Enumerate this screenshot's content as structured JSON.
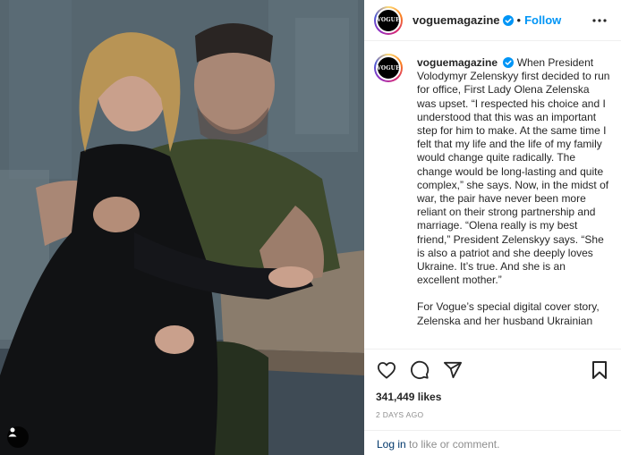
{
  "post": {
    "photo_alt": "",
    "author": {
      "username": "voguemagazine",
      "avatar_text": "VOGUE",
      "verified": true
    },
    "header": {
      "dot": "•",
      "follow_label": "Follow",
      "more_icon": "more-horizontal-icon"
    },
    "caption": {
      "username": "voguemagazine",
      "paragraph_1": "When President Volodymyr Zelenskyy first decided to run for office, First Lady Olena Zelenska was upset. “I respected his choice and I understood that this was an important step for him to make. At the same time I felt that my life and the life of my family would change quite radically. The change would be long-lasting and quite complex,” she says. Now, in the midst of war, the pair have never been more reliant on their strong partnership and marriage. “Olena really is my best friend,” President Zelenskyy says. “She is also a patriot and she deeply loves Ukraine. It’s true. And she is an excellent mother.”",
      "paragraph_2": "For Vogue’s special digital cover story, Zelenska and her husband Ukrainian"
    },
    "actions": {
      "like_icon": "heart-icon",
      "comment_icon": "comment-icon",
      "share_icon": "share-icon",
      "save_icon": "bookmark-icon"
    },
    "likes": "341,449 likes",
    "time_ago": "2 DAYS AGO",
    "login": {
      "link_label": "Log in",
      "rest_text": " to like or comment."
    }
  },
  "colors": {
    "link": "#0095f6",
    "verified": "#0095f6",
    "muted": "#8e8e8e",
    "text": "#262626"
  }
}
